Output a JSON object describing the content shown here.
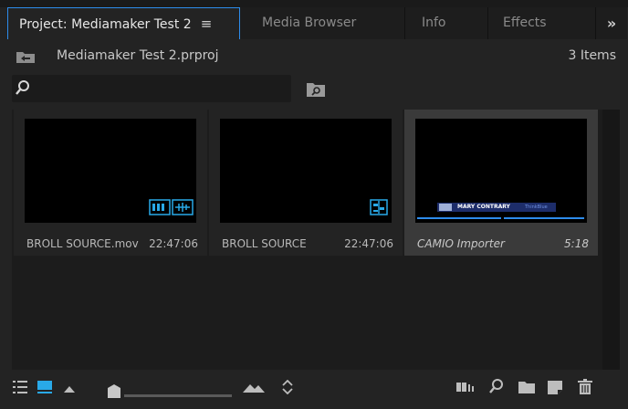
{
  "tabs": [
    {
      "label": "Project: Mediamaker Test 2",
      "active": true
    },
    {
      "label": "Media Browser",
      "active": false
    },
    {
      "label": "Info",
      "active": false
    },
    {
      "label": "Effects",
      "active": false
    }
  ],
  "tab_menu_glyph": "≡",
  "overflow_glyph": "»",
  "project": {
    "file_name": "Mediamaker Test 2.prproj",
    "items_count": "3 Items"
  },
  "search": {
    "placeholder": ""
  },
  "items": [
    {
      "name": "BROLL SOURCE.mov",
      "duration": "22:47:06",
      "icon": "clip-video-audio-icon",
      "selected": false
    },
    {
      "name": "BROLL SOURCE",
      "duration": "22:47:06",
      "icon": "sequence-icon",
      "selected": false
    },
    {
      "name": "CAMIO Importer",
      "duration": "5:18",
      "icon": "graphic-lower-third-thumbnail",
      "selected": true
    }
  ],
  "thumbnail_text": {
    "lower_third_name": "MARY CONTRARY",
    "lower_third_tag": "ThinkBlue"
  },
  "toolbar": {
    "list_view_icon": "list-view-icon",
    "icon_view_icon": "icon-view-icon",
    "zoom": {
      "value": 0.0
    },
    "sort_icon": "sort-icon",
    "automate_icon": "automate-to-sequence-icon",
    "find_icon": "find-icon",
    "new_bin_icon": "new-bin-icon",
    "new_item_icon": "new-item-icon",
    "clear_icon": "trash-icon"
  },
  "colors": {
    "accent": "#2d8ceb",
    "icon_blue": "#29a9e8",
    "panel_bg": "#232323",
    "grid_bg": "#1c1c1c"
  }
}
